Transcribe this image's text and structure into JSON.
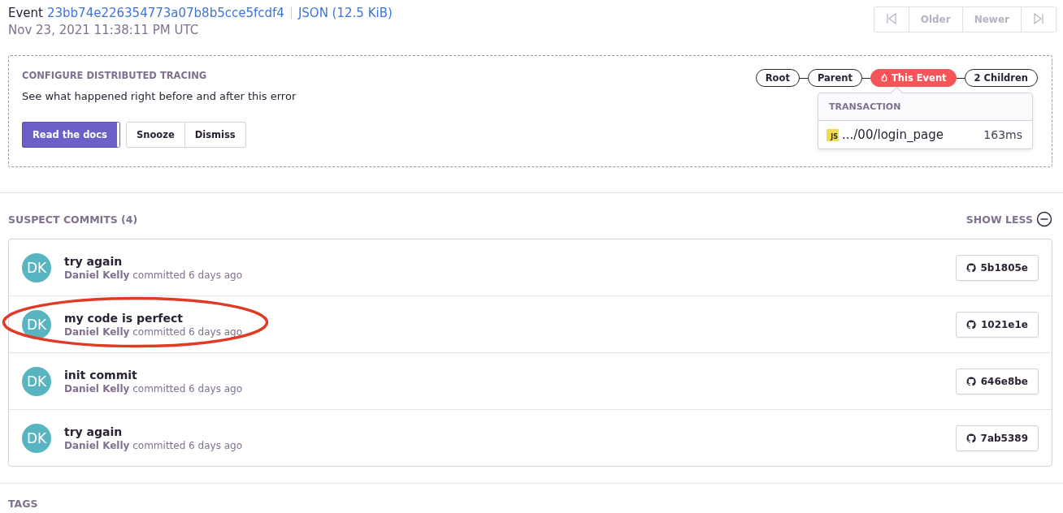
{
  "event": {
    "label": "Event",
    "id": "23bb74e226354773a07b8b5cce5fcdf4",
    "json_link": "JSON (12.5 KiB)",
    "timestamp": "Nov 23, 2021 11:38:11 PM UTC"
  },
  "pagination": [
    {
      "kind": "first",
      "disabled": true
    },
    {
      "kind": "text",
      "label": "Older",
      "disabled": true
    },
    {
      "kind": "text",
      "label": "Newer",
      "disabled": true
    },
    {
      "kind": "last",
      "disabled": true
    }
  ],
  "tracing": {
    "title": "CONFIGURE DISTRIBUTED TRACING",
    "description": "See what happened right before and after this error",
    "buttons": [
      {
        "label": "Read the docs",
        "kind": "primary"
      },
      {
        "label": "Snooze",
        "kind": "default"
      },
      {
        "label": "Dismiss",
        "kind": "default"
      }
    ],
    "trace_nav": [
      {
        "label": "Root",
        "selected": false
      },
      {
        "label": "Parent",
        "selected": false
      },
      {
        "label": "This Event",
        "selected": true
      },
      {
        "label": "2 Children",
        "selected": false
      }
    ],
    "popover": {
      "heading": "TRANSACTION",
      "icon_text": "JS",
      "name": ".../00/login_page",
      "duration": "163ms"
    }
  },
  "suspect_commits": {
    "title": "SUSPECT COMMITS (4)",
    "toggle": "SHOW LESS",
    "commits": [
      {
        "initials": "DK",
        "message": "try again",
        "author": "Daniel Kelly",
        "meta": "committed 6 days ago",
        "sha": "5b1805e",
        "circled": false
      },
      {
        "initials": "DK",
        "message": "my code is perfect",
        "author": "Daniel Kelly",
        "meta": "committed 6 days ago",
        "sha": "1021e1e",
        "circled": true
      },
      {
        "initials": "DK",
        "message": "init commit",
        "author": "Daniel Kelly",
        "meta": "committed 6 days ago",
        "sha": "646e8be",
        "circled": false
      },
      {
        "initials": "DK",
        "message": "try again",
        "author": "Daniel Kelly",
        "meta": "committed 6 days ago",
        "sha": "7ab5389",
        "circled": false
      }
    ]
  },
  "tags": {
    "title": "TAGS"
  }
}
